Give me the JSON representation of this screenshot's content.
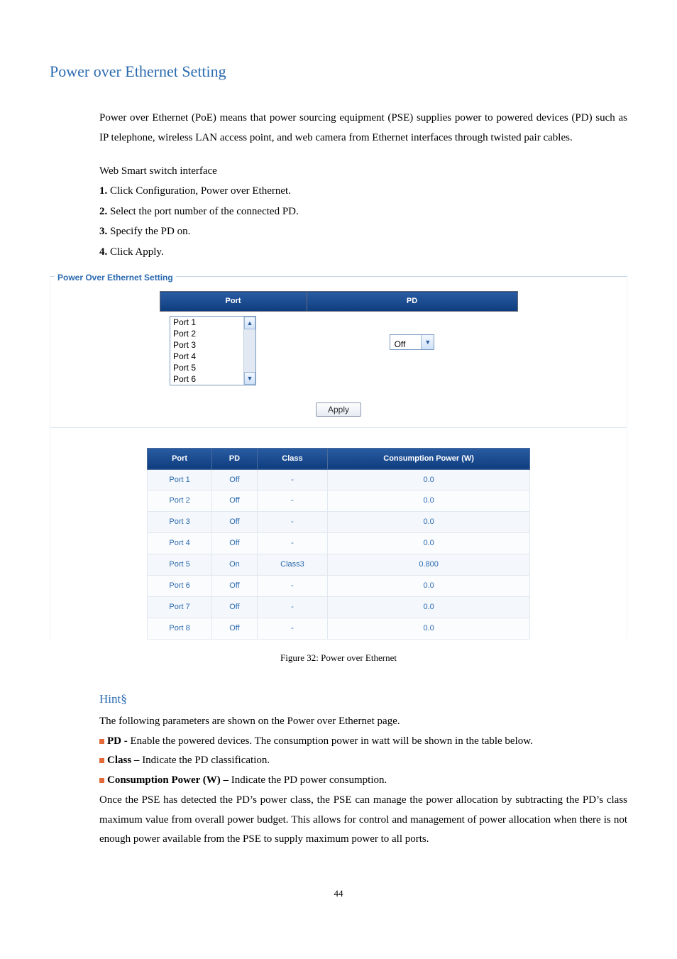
{
  "title": "Power over Ethernet Setting",
  "intro": "Power over Ethernet (PoE) means that power sourcing equipment (PSE) supplies power to powered devices (PD) such as IP telephone, wireless LAN access point, and web camera from Ethernet interfaces through twisted pair cables.",
  "interface_label": "Web Smart switch interface",
  "steps": {
    "s1_num": "1.",
    "s1_text": " Click Configuration, Power over Ethernet.",
    "s2_num": "2.",
    "s2_text": " Select the port number of the connected PD.",
    "s3_num": "3.",
    "s3_text": " Specify the PD on.",
    "s4_num": "4.",
    "s4_text": " Click Apply."
  },
  "fieldset_legend": "Power Over Ethernet Setting",
  "config": {
    "port_header": "Port",
    "pd_header": "PD",
    "port_items": [
      "Port 1",
      "Port 2",
      "Port 3",
      "Port 4",
      "Port 5",
      "Port 6"
    ],
    "pd_value": "Off",
    "apply_label": "Apply"
  },
  "status": {
    "headers": {
      "port": "Port",
      "pd": "PD",
      "class": "Class",
      "cpw": "Consumption Power (W)"
    },
    "rows": [
      {
        "port": "Port 1",
        "pd": "Off",
        "class": "-",
        "cpw": "0.0"
      },
      {
        "port": "Port 2",
        "pd": "Off",
        "class": "-",
        "cpw": "0.0"
      },
      {
        "port": "Port 3",
        "pd": "Off",
        "class": "-",
        "cpw": "0.0"
      },
      {
        "port": "Port 4",
        "pd": "Off",
        "class": "-",
        "cpw": "0.0"
      },
      {
        "port": "Port 5",
        "pd": "On",
        "class": "Class3",
        "cpw": "0.800"
      },
      {
        "port": "Port 6",
        "pd": "Off",
        "class": "-",
        "cpw": "0.0"
      },
      {
        "port": "Port 7",
        "pd": "Off",
        "class": "-",
        "cpw": "0.0"
      },
      {
        "port": "Port 8",
        "pd": "Off",
        "class": "-",
        "cpw": "0.0"
      }
    ]
  },
  "figure_caption": "Figure 32: Power over Ethernet",
  "hint": {
    "title": "Hint§",
    "intro": "The following parameters are shown on the Power over Ethernet page.",
    "pd_label": "PD - ",
    "pd_text": "Enable the powered devices. The consumption power in watt will be shown in the table below.",
    "class_label": "Class – ",
    "class_text": "Indicate the PD classification.",
    "cpw_label": "Consumption Power (W) – ",
    "cpw_text": "Indicate the PD power consumption.",
    "note": "Once the PSE has detected the PD’s power class, the PSE can manage the power allocation by subtracting the PD’s class maximum value from overall power budget. This allows for control and management of power allocation when there is not enough power available from the PSE to supply maximum power to all ports."
  },
  "page_number": "44"
}
